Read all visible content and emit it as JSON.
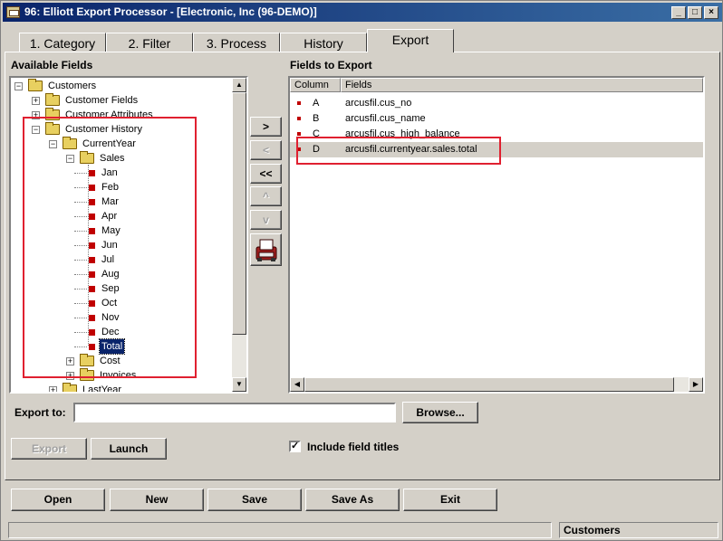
{
  "window": {
    "title": "96: Elliott Export Processor - [Electronic, Inc (96-DEMO)]"
  },
  "title_buttons": {
    "minimize": "_",
    "maximize": "□",
    "close": "×"
  },
  "tabs": [
    "1. Category",
    "2. Filter",
    "3. Process",
    "History",
    "Export"
  ],
  "available_fields": {
    "label": "Available Fields",
    "tree": [
      {
        "label": "Customers",
        "type": "folder",
        "expander": "−"
      },
      {
        "label": "Customer Fields",
        "type": "folder",
        "expander": "+"
      },
      {
        "label": "Customer Attributes",
        "type": "folder",
        "expander": "+"
      },
      {
        "label": "Customer History",
        "type": "folder",
        "expander": "−"
      },
      {
        "label": "CurrentYear",
        "type": "folder",
        "expander": "−"
      },
      {
        "label": "Sales",
        "type": "folder",
        "expander": "−"
      },
      {
        "label": "Jan",
        "type": "field"
      },
      {
        "label": "Feb",
        "type": "field"
      },
      {
        "label": "Mar",
        "type": "field"
      },
      {
        "label": "Apr",
        "type": "field"
      },
      {
        "label": "May",
        "type": "field"
      },
      {
        "label": "Jun",
        "type": "field"
      },
      {
        "label": "Jul",
        "type": "field"
      },
      {
        "label": "Aug",
        "type": "field"
      },
      {
        "label": "Sep",
        "type": "field"
      },
      {
        "label": "Oct",
        "type": "field"
      },
      {
        "label": "Nov",
        "type": "field"
      },
      {
        "label": "Dec",
        "type": "field"
      },
      {
        "label": "Total",
        "type": "field",
        "selected": true
      },
      {
        "label": "Cost",
        "type": "folder",
        "expander": "+"
      },
      {
        "label": "Invoices",
        "type": "folder",
        "expander": "+"
      },
      {
        "label": "LastYear",
        "type": "folder",
        "expander": "+"
      }
    ]
  },
  "mover_buttons": {
    "add": ">",
    "remove": "<",
    "remove_all": "<<",
    "up": "^",
    "down": "v",
    "export_icon": "printer-icon"
  },
  "fields_to_export": {
    "label": "Fields to Export",
    "columns": [
      "Column",
      "Fields"
    ],
    "rows": [
      {
        "column": "A",
        "field": "arcusfil.cus_no"
      },
      {
        "column": "B",
        "field": "arcusfil.cus_name"
      },
      {
        "column": "C",
        "field": "arcusfil.cus_high_balance"
      },
      {
        "column": "D",
        "field": "arcusfil.currentyear.sales.total",
        "selected": true
      }
    ]
  },
  "export_to": {
    "label": "Export to:",
    "value": "",
    "browse_label": "Browse..."
  },
  "actions": {
    "export_label": "Export",
    "launch_label": "Launch"
  },
  "include_titles": {
    "label": "Include field titles",
    "checked": true,
    "mark": "✓"
  },
  "footer_buttons": {
    "open": "Open",
    "new": "New",
    "save": "Save",
    "save_as": "Save As",
    "exit": "Exit"
  },
  "status": {
    "left": "",
    "right": "Customers"
  },
  "colors": {
    "highlight_box": "#e02030",
    "field_marker": "#c00000",
    "selection": "#0a246a"
  }
}
